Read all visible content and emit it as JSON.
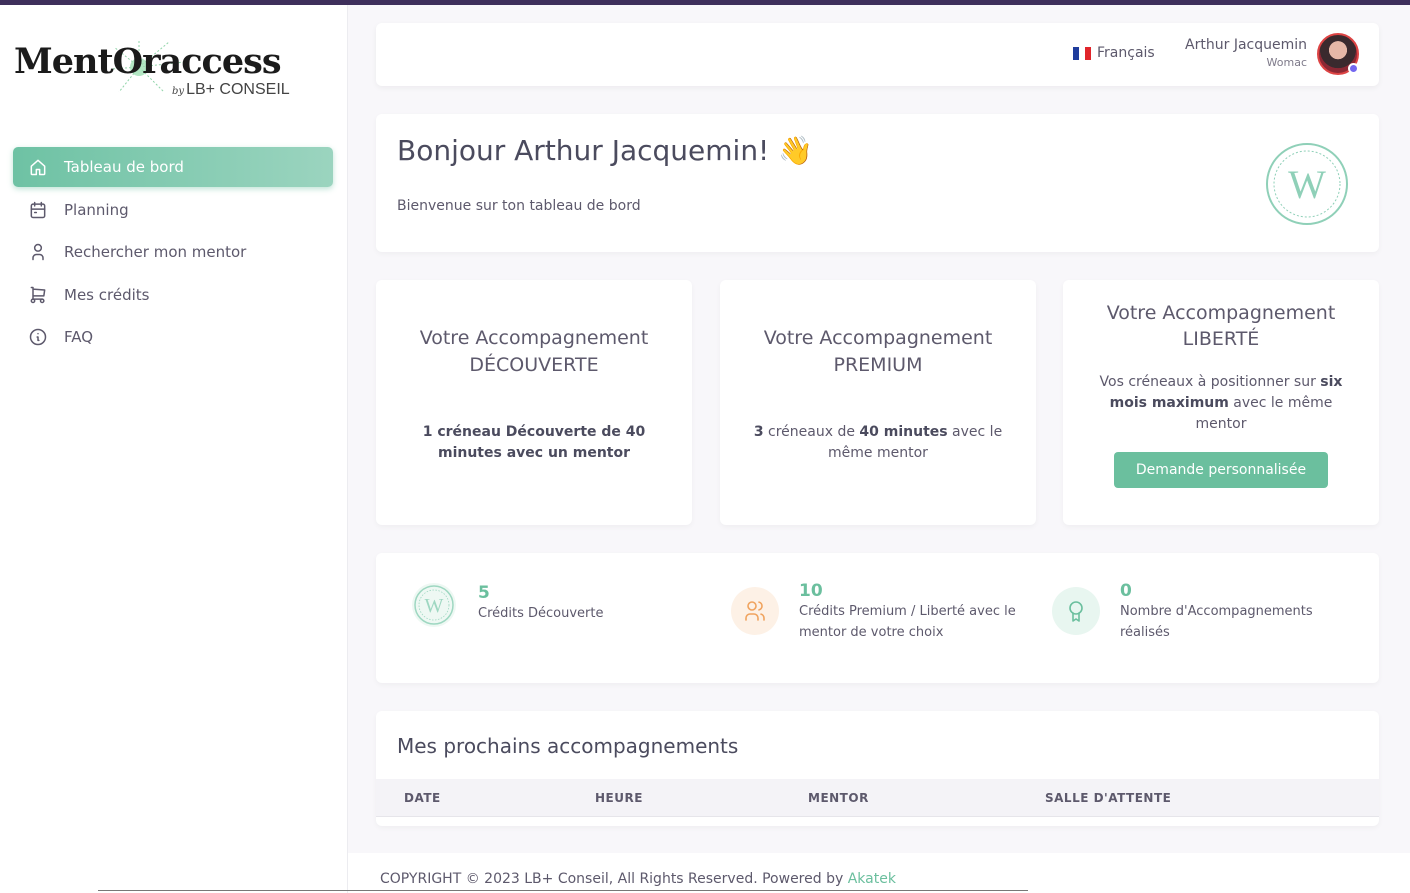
{
  "logo": {
    "main": "MentOraccess",
    "by": "by",
    "sub": "LB+ CONSEIL"
  },
  "sidebar": {
    "items": [
      {
        "label": "Tableau de bord",
        "icon": "home-icon",
        "active": true
      },
      {
        "label": "Planning",
        "icon": "calendar-icon",
        "active": false
      },
      {
        "label": "Rechercher mon mentor",
        "icon": "user-icon",
        "active": false
      },
      {
        "label": "Mes crédits",
        "icon": "cart-icon",
        "active": false
      },
      {
        "label": "FAQ",
        "icon": "info-icon",
        "active": false
      }
    ]
  },
  "header": {
    "language": "Français",
    "user_name": "Arthur Jacquemin",
    "user_role": "Womac"
  },
  "welcome": {
    "title": "Bonjour Arthur Jacquemin!",
    "emoji": "👋",
    "subtitle": "Bienvenue sur ton tableau de bord",
    "badge_letter": "W"
  },
  "offers": [
    {
      "title_line1": "Votre Accompagnement",
      "title_line2": "DÉCOUVERTE",
      "desc_bold": "1 créneau Découverte de 40 minutes avec un mentor"
    },
    {
      "title_line1": "Votre Accompagnement",
      "title_line2": "PREMIUM",
      "desc_p1": "3",
      "desc_p2": " créneaux de ",
      "desc_p3": "40 minutes",
      "desc_p4": " avec le même mentor"
    },
    {
      "title_line1": "Votre Accompagnement",
      "title_line2": "LIBERTÉ",
      "desc_p1": "Vos créneaux à positionner sur ",
      "desc_p2": "six mois maximum",
      "desc_p3": " avec le même mentor",
      "button": "Demande personnalisée"
    }
  ],
  "stats": [
    {
      "value": "5",
      "label": "Crédits Découverte",
      "icon": "w-badge-icon"
    },
    {
      "value": "10",
      "label": "Crédits Premium / Liberté avec le mentor de votre choix",
      "icon": "users-icon"
    },
    {
      "value": "0",
      "label": "Nombre d'Accompagnements réalisés",
      "icon": "award-icon"
    }
  ],
  "upcoming": {
    "title": "Mes prochains accompagnements",
    "columns": [
      "DATE",
      "HEURE",
      "MENTOR",
      "SALLE D'ATTENTE"
    ]
  },
  "footer": {
    "text": "COPYRIGHT © 2023 LB+ Conseil, All Rights Reserved. Powered by ",
    "link": "Akatek"
  },
  "colors": {
    "accent": "#6bbf9e",
    "topbar": "#3e2f5b",
    "avatar_status": "#7367f0"
  }
}
